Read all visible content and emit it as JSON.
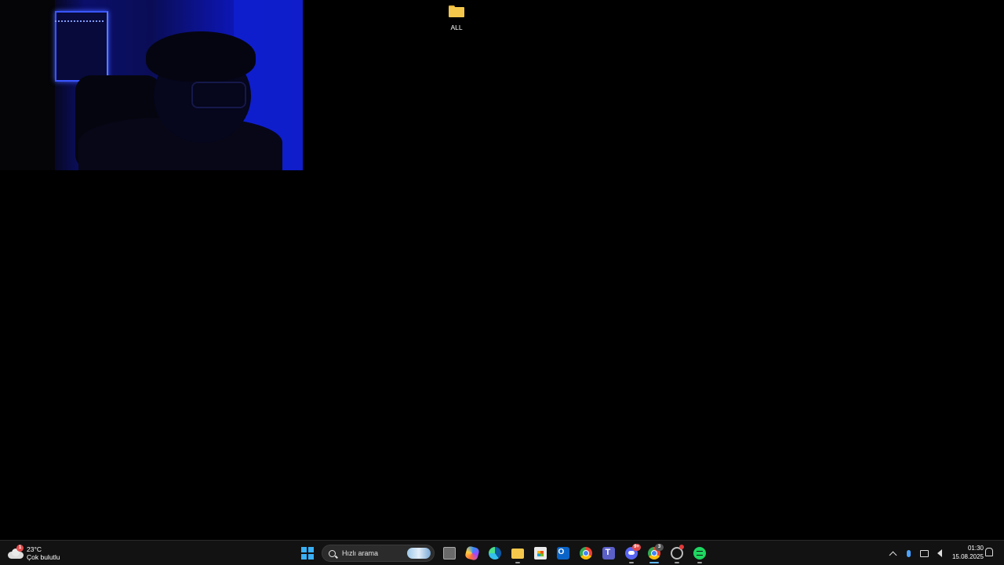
{
  "desktop": {
    "icons": [
      {
        "label": "ALL",
        "icon": "folder-icon"
      }
    ]
  },
  "webcam_overlay": {
    "description_icon": "webcam-feed"
  },
  "taskbar": {
    "weather": {
      "temperature": "23°C",
      "condition": "Çok bulutlu",
      "badge": "1",
      "icon": "cloud-icon"
    },
    "search": {
      "placeholder": "Hızlı arama"
    },
    "apps": [
      {
        "name": "start",
        "icon": "windows-start-icon"
      },
      {
        "name": "task-view",
        "icon": "task-view-icon"
      },
      {
        "name": "copilot",
        "icon": "copilot-icon"
      },
      {
        "name": "edge",
        "icon": "edge-icon"
      },
      {
        "name": "file-explorer",
        "icon": "folder-icon"
      },
      {
        "name": "store",
        "icon": "store-icon"
      },
      {
        "name": "outlook",
        "icon": "outlook-icon"
      },
      {
        "name": "chrome",
        "icon": "chrome-icon"
      },
      {
        "name": "teams",
        "icon": "teams-icon"
      },
      {
        "name": "discord",
        "icon": "discord-icon",
        "badge": "9+"
      },
      {
        "name": "chrome-profile",
        "icon": "chrome-icon",
        "badge": "3"
      },
      {
        "name": "app-ring",
        "icon": "ring-app-icon"
      },
      {
        "name": "spotify",
        "icon": "spotify-icon"
      }
    ],
    "tray": {
      "time": "01:30",
      "date": "15.08.2025"
    }
  },
  "colors": {
    "desktop_bg": "#000000",
    "taskbar_bg": "#121212",
    "accent": "#62b7ff"
  }
}
